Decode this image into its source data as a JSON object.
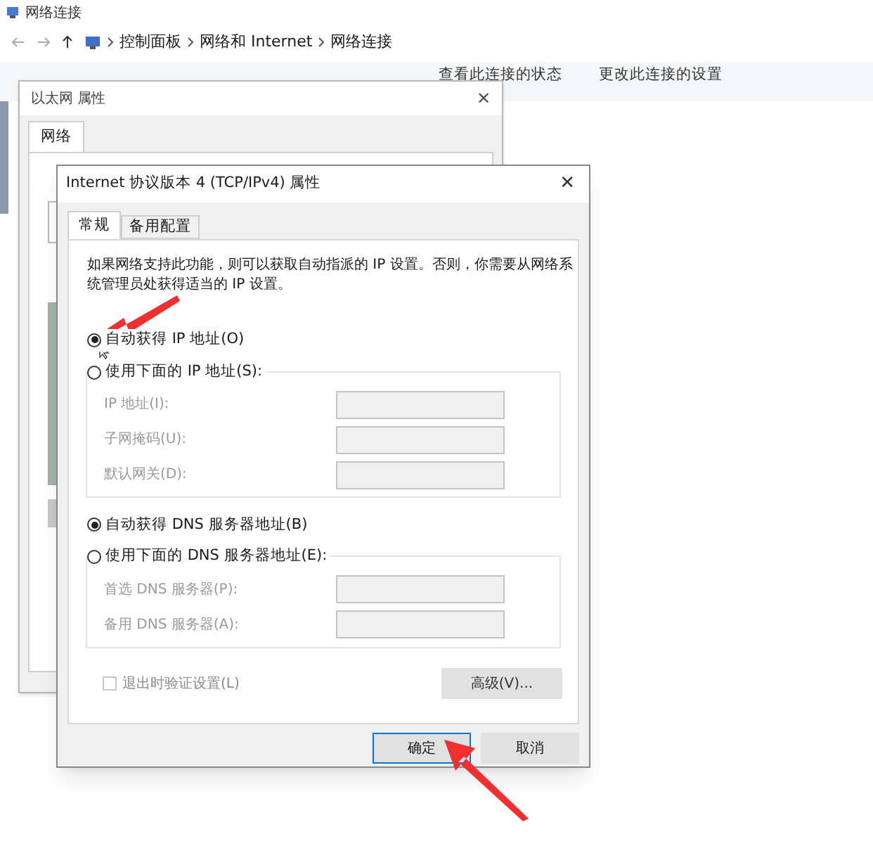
{
  "explorer": {
    "title": "网络连接",
    "breadcrumbs": [
      "控制面板",
      "网络和 Internet",
      "网络连接"
    ],
    "toolbar": [
      "查看此连接的状态",
      "更改此连接的设置"
    ]
  },
  "ethernet_dialog": {
    "title": "以太网 属性",
    "close": "✕",
    "tabs": [
      {
        "label": "网络",
        "selected": true
      }
    ]
  },
  "ipv4_dialog": {
    "title": "Internet 协议版本 4 (TCP/IPv4) 属性",
    "close": "✕",
    "tabs": [
      {
        "label": "常规",
        "selected": true
      },
      {
        "label": "备用配置",
        "selected": false
      }
    ],
    "description": "如果网络支持此功能，则可以获取自动指派的 IP 设置。否则，你需要从网络系统管理员处获得适当的 IP 设置。",
    "ip_options": [
      {
        "label": "自动获得 IP 地址(O)",
        "selected": true
      },
      {
        "label": "使用下面的 IP 地址(S):",
        "selected": false
      }
    ],
    "ip_fields": [
      {
        "label": "IP 地址(I):",
        "disabled": true
      },
      {
        "label": "子网掩码(U):",
        "disabled": true
      },
      {
        "label": "默认网关(D):",
        "disabled": true
      }
    ],
    "dns_options": [
      {
        "label": "自动获得 DNS 服务器地址(B)",
        "selected": true
      },
      {
        "label": "使用下面的 DNS 服务器地址(E):",
        "selected": false
      }
    ],
    "dns_fields": [
      {
        "label": "首选 DNS 服务器(P):",
        "disabled": true
      },
      {
        "label": "备用 DNS 服务器(A):",
        "disabled": true
      }
    ],
    "validate_checkbox": {
      "label": "退出时验证设置(L)",
      "checked": false,
      "disabled": true
    },
    "advanced_button": "高级(V)...",
    "buttons": [
      {
        "label": "确定",
        "selected": true
      },
      {
        "label": "取消",
        "selected": false
      }
    ]
  }
}
